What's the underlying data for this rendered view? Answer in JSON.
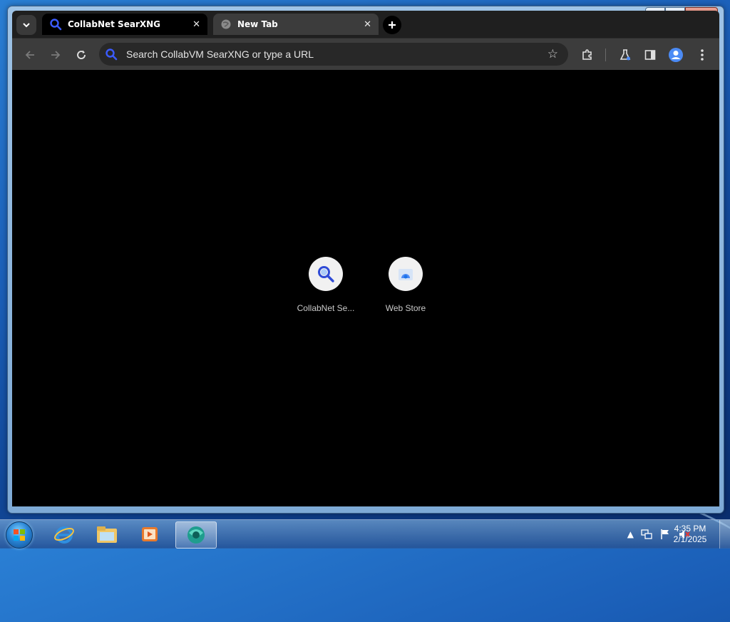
{
  "window": {
    "controls": {
      "minimize": "—",
      "maximize": "☐",
      "close": "✕"
    }
  },
  "tabs": [
    {
      "title": "CollabNet SearXNG",
      "icon": "search-icon",
      "active": true
    },
    {
      "title": "New Tab",
      "icon": "globe-icon",
      "active": false
    }
  ],
  "toolbar": {
    "omnibox_placeholder": "Search CollabVM SearXNG or type a URL",
    "icons": [
      "back-arrow-icon",
      "forward-arrow-icon",
      "reload-icon",
      "star-icon",
      "extensions-icon",
      "labs-flask-icon",
      "side-panel-icon",
      "profile-icon",
      "menu-kebab-icon"
    ]
  },
  "shortcuts": [
    {
      "label": "CollabNet Se...",
      "icon": "search-icon"
    },
    {
      "label": "Web Store",
      "icon": "web-store-icon"
    }
  ],
  "taskbar": {
    "pinned": [
      "internet-explorer-icon",
      "file-explorer-icon",
      "media-player-icon",
      "browser-icon"
    ],
    "tray_icons": [
      "show-hidden-icons-arrow",
      "network-icon",
      "action-center-flag-icon",
      "volume-muted-icon"
    ],
    "time": "4:35 PM",
    "date": "2/1/2025"
  },
  "colors": {
    "accent_blue": "#1a4fd8",
    "tab_strip": "#1f1f1f",
    "toolbar": "#3c3c3c",
    "content_bg": "#000000"
  }
}
